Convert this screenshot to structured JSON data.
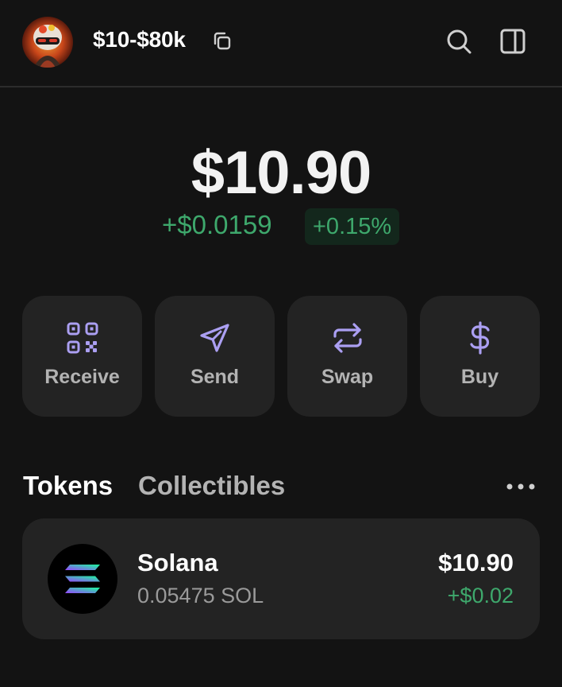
{
  "header": {
    "account_name": "$10-$80k",
    "icons": [
      "avatar",
      "copy-icon",
      "search-icon",
      "sidepanel-icon"
    ]
  },
  "balance": {
    "total": "$10.90",
    "change_amount": "+$0.0159",
    "change_percent": "+0.15%"
  },
  "actions": [
    {
      "label": "Receive",
      "icon": "qr-code-icon"
    },
    {
      "label": "Send",
      "icon": "send-icon"
    },
    {
      "label": "Swap",
      "icon": "swap-icon"
    },
    {
      "label": "Buy",
      "icon": "dollar-icon"
    }
  ],
  "tabs": [
    {
      "label": "Tokens",
      "active": true
    },
    {
      "label": "Collectibles",
      "active": false
    }
  ],
  "tokens": [
    {
      "name": "Solana",
      "amount": "0.05475 SOL",
      "value": "$10.90",
      "change": "+$0.02",
      "icon": "solana-logo-icon"
    }
  ],
  "colors": {
    "background": "#131313",
    "card": "#232323",
    "accent": "#ab9ff2",
    "positive": "#3ea86c",
    "positive_bg": "#13271c",
    "muted_text": "#b3b3b3"
  }
}
